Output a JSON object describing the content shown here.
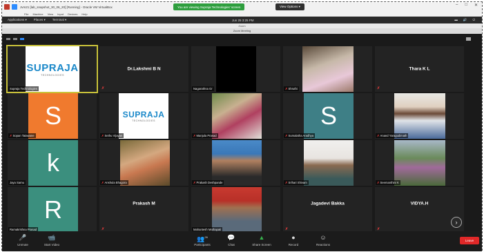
{
  "window": {
    "title": "Jvm21 [lab_snapshot_30_06_20] [Running] - Oracle VM VirtualBox",
    "share_banner": "You are viewing Supraja Technologies' screen",
    "view_options": "View Options ▾",
    "menu": [
      "File",
      "Machine",
      "View",
      "Input",
      "Devices",
      "Help"
    ]
  },
  "gnome": {
    "applications": "Applications ▾",
    "places": "Places ▾",
    "terminal": "Terminal ▾",
    "clock": "Jun 25  3:25 PM",
    "tray": [
      "▬",
      "🔊",
      "⏻"
    ],
    "subtitle": "Zoom"
  },
  "zoom": {
    "window_title": "Zoom Meeting",
    "participants": [
      {
        "name": "Supraja Technologies",
        "type": "logo",
        "logo": "SUPRAJA",
        "logo_sub": "TECHNOLOGIES",
        "muted": false
      },
      {
        "name": "Dr.Lakshmi B N",
        "type": "name",
        "muted": true
      },
      {
        "name": "Nagarathna Gr",
        "type": "black",
        "muted": false
      },
      {
        "name": "Shruthi",
        "type": "photo",
        "muted": true
      },
      {
        "name": "Thara K L",
        "type": "name",
        "muted": true
      },
      {
        "name": "Sopan Tatawane",
        "type": "avatar",
        "letter": "S",
        "color": "#f07a2e",
        "muted": true
      },
      {
        "name": "Sethu Vijayan",
        "type": "logo",
        "logo": "SUPRAJA",
        "logo_sub": "TECHNOLOGIES",
        "muted": true
      },
      {
        "name": "Manjula Prasad",
        "type": "photo",
        "muted": true
      },
      {
        "name": "Sumalatha Aradhya",
        "type": "avatar",
        "letter": "S",
        "color": "#3e7f86",
        "muted": true
      },
      {
        "name": "Anand Yaragudimath",
        "type": "photo",
        "muted": true
      },
      {
        "name": "Jaya Samu",
        "type": "avatar",
        "letter": "k",
        "color": "#3b8f7e",
        "muted": false
      },
      {
        "name": "Anshula Bhagora",
        "type": "photo",
        "muted": true
      },
      {
        "name": "Prakash Deshpande",
        "type": "photo",
        "muted": true
      },
      {
        "name": "Srihari Shivam",
        "type": "photo",
        "muted": true
      },
      {
        "name": "Seemanthini K",
        "type": "photo",
        "muted": true
      },
      {
        "name": "Ramakrishna Prasad",
        "type": "avatar",
        "letter": "R",
        "color": "#3b8f7e",
        "muted": false
      },
      {
        "name": "Prakash M",
        "type": "name",
        "muted": true
      },
      {
        "name": "Mahantesh Mathapati",
        "type": "photo",
        "muted": false
      },
      {
        "name": "Jagadevi Bakka",
        "type": "name",
        "muted": true
      },
      {
        "name": "VIDYA.H",
        "type": "name",
        "muted": true
      }
    ],
    "mute_symbol": "✗"
  },
  "toolbar": {
    "unmute": "Unmute",
    "start_video": "Start Video",
    "participants": "Participants",
    "participants_count": "26",
    "chat": "Chat",
    "share_screen": "Share Screen",
    "record": "Record",
    "reactions": "Reactions",
    "end": "Leave"
  },
  "icons": {
    "mic": "mic-off-icon",
    "video": "video-off-icon",
    "participants": "participants-icon",
    "chat": "chat-icon",
    "share": "share-screen-icon",
    "record": "record-icon",
    "reactions": "reactions-icon",
    "next_page": "chevron-right-icon"
  },
  "colors": {
    "zoom_bg": "#1a1a1a",
    "active_speaker": "#c9c23a",
    "share_banner": "#2e9e3e",
    "end_button": "#e02828",
    "mute_red": "#e43b3b"
  }
}
